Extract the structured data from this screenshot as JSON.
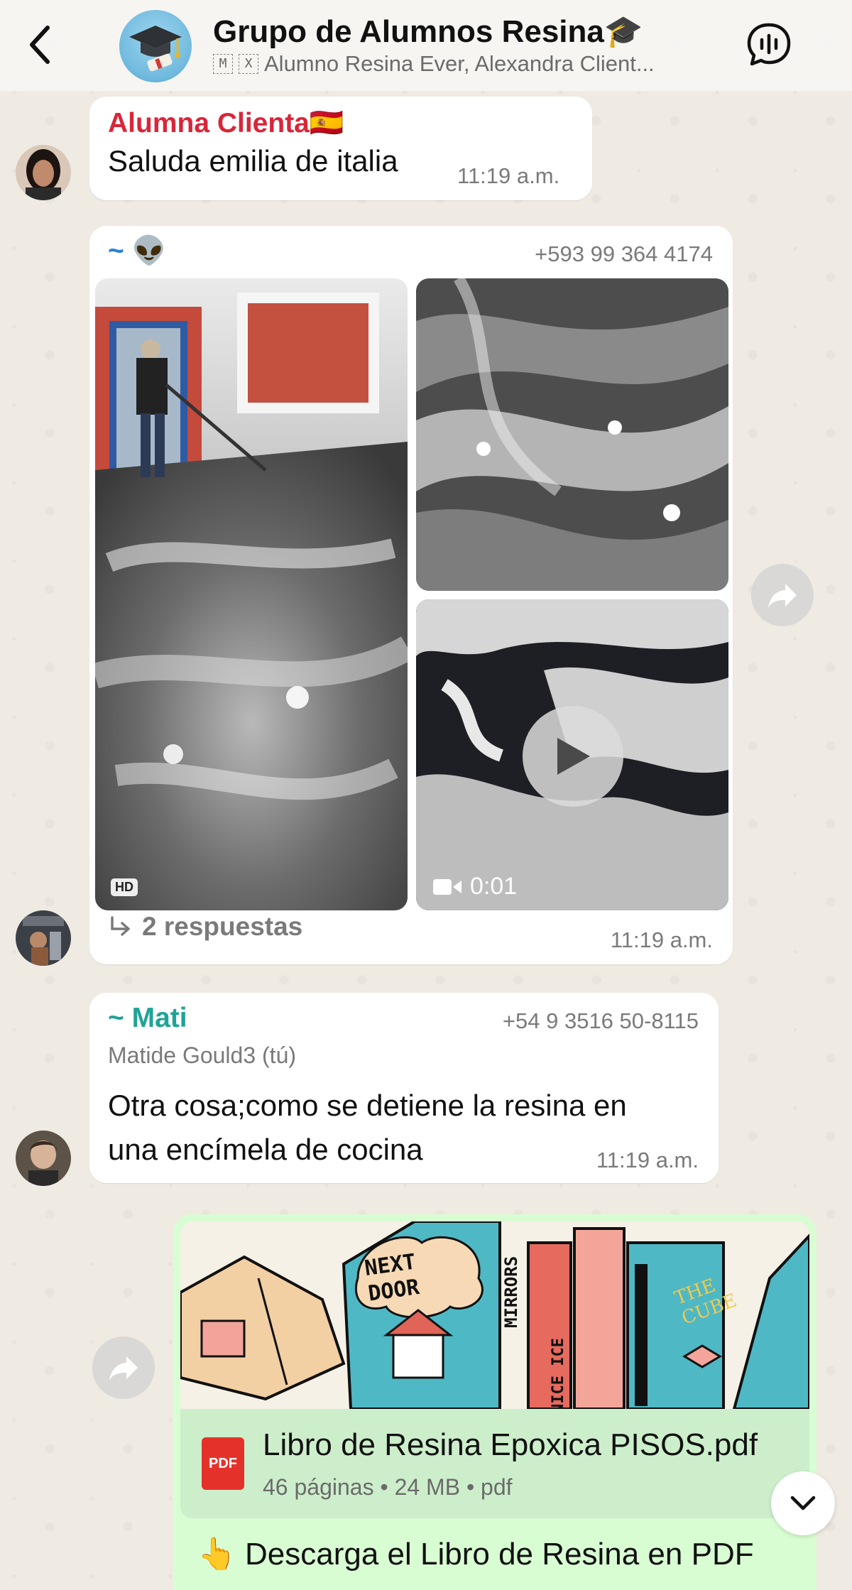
{
  "header": {
    "title": "Grupo de Alumnos Resina🎓",
    "sub_box_1": "M",
    "sub_box_2": "X",
    "subtitle": "Alumno Resina Ever, Alexandra Client..."
  },
  "messages": {
    "m1": {
      "sender": "Alumna Clienta🇪🇸",
      "text": "Saluda emilia de italia",
      "time": "11:19 a.m."
    },
    "m2": {
      "sender": "~ 👽",
      "phone": "+593 99 364 4174",
      "hd_badge": "HD",
      "video_duration": "0:01",
      "replies": "2 respuestas",
      "time": "11:19 a.m."
    },
    "m3": {
      "sender": "~ Mati",
      "phone": "+54 9 3516 50-8115",
      "quoted_name": "Matide Gould3 (tú)",
      "text_line1": "Otra cosa;como se detiene la resina en",
      "text_line2": "una encímela de cocina",
      "time": "11:19 a.m."
    },
    "m4": {
      "preview_words": [
        "NEXT",
        "DOOR",
        "MIRRORS",
        "NICE ICE",
        "THE",
        "CUBE"
      ],
      "pdf_label": "PDF",
      "doc_name": "Libro de Resina Epoxica PISOS.pdf",
      "doc_meta": "46 páginas • 24 MB • pdf",
      "caption": "👆 Descarga el Libro de Resina en PDF"
    }
  },
  "colors": {
    "chat_bg": "#efeae2",
    "sender_red": "#d8263a",
    "sender_teal": "#20a397",
    "sender_blue": "#2a7fd4",
    "outgoing_bubble": "#d9fdd3"
  },
  "icons": [
    "back-icon",
    "voice-chat-icon",
    "forward-icon",
    "play-icon",
    "video-icon",
    "reply-arrow-icon",
    "pdf-icon",
    "chevron-down-icon"
  ]
}
